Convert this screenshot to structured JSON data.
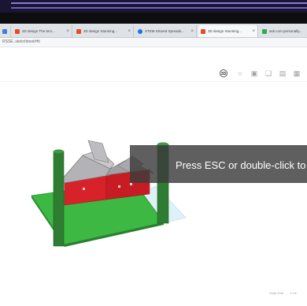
{
  "browser": {
    "tabs": [
      {
        "title": "",
        "favicon_color": "#4a7bd0"
      },
      {
        "title": "3D design The tem...",
        "favicon_color": "#e44d26"
      },
      {
        "title": "3D design Stunning...",
        "favicon_color": "#e44d26"
      },
      {
        "title": "STEM Shared Spreads...",
        "favicon_color": "#1a73e8"
      },
      {
        "title": "3D design Stunning...",
        "favicon_color": "#e44d26",
        "active": true
      },
      {
        "title": "ask.com personally...",
        "favicon_color": "#34a853"
      }
    ],
    "tab_close_glyph": "×",
    "url": "RSSE..sketchbookHit"
  },
  "toolbar": {
    "icons": [
      "view-cube-icon",
      "lightbulb-icon",
      "shape-icon",
      "copy-icon",
      "paste-icon",
      "align-icon"
    ],
    "view_cube_label": "3D"
  },
  "overlay": {
    "message": "Press ESC or double-click to"
  },
  "footer": {
    "left": "Snap Grid",
    "right": "1.0 ▾"
  },
  "colors": {
    "accent": "#7a6fd0",
    "ground": "#3db843",
    "house_walls": "#d8222a",
    "roof": "#a9a9ad",
    "pillars": "#2e7d32"
  }
}
